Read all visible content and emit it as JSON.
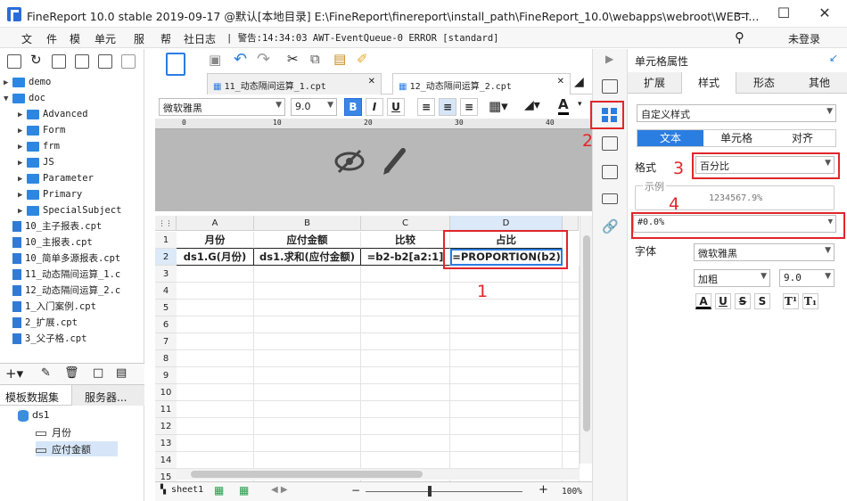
{
  "titlebar": {
    "title": "FineReport 10.0 stable 2019-09-17 @默认[本地目录]    E:\\FineReport\\finereport\\install_path\\FineReport_10.0\\webapps\\webroot\\WEB-I...",
    "minimize": "—",
    "maximize": "☐",
    "close": "✕"
  },
  "menubar": {
    "items": [
      "文",
      "件",
      "模",
      "单元",
      "服",
      "帮",
      "社日志"
    ],
    "status": "| 警告:14:34:03 AWT-EventQueue-0 ERROR [standard]",
    "login": "未登录"
  },
  "tree": {
    "items": [
      {
        "label": "demo",
        "type": "folder",
        "indent": 0
      },
      {
        "label": "doc",
        "type": "folder",
        "indent": 0
      },
      {
        "label": "Advanced",
        "type": "folder",
        "indent": 1
      },
      {
        "label": "Form",
        "type": "folder",
        "indent": 1
      },
      {
        "label": "frm",
        "type": "folder",
        "indent": 1
      },
      {
        "label": "JS",
        "type": "folder",
        "indent": 1
      },
      {
        "label": "Parameter",
        "type": "folder",
        "indent": 1
      },
      {
        "label": "Primary",
        "type": "folder",
        "indent": 1
      },
      {
        "label": "SpecialSubject",
        "type": "folder",
        "indent": 1
      },
      {
        "label": "10_主子报表.cpt",
        "type": "file",
        "indent": 0
      },
      {
        "label": "10_主报表.cpt",
        "type": "file",
        "indent": 0
      },
      {
        "label": "10_简单多源报表.cpt",
        "type": "file",
        "indent": 0
      },
      {
        "label": "11_动态隔间运算_1.c",
        "type": "file",
        "indent": 0
      },
      {
        "label": "12_动态隔间运算_2.c",
        "type": "file",
        "indent": 0
      },
      {
        "label": "1_入门案例.cpt",
        "type": "file",
        "indent": 0
      },
      {
        "label": "2_扩展.cpt",
        "type": "file",
        "indent": 0
      },
      {
        "label": "3_父子格.cpt",
        "type": "file",
        "indent": 0
      }
    ]
  },
  "dataset_panel": {
    "tabs": [
      "模板数据集",
      "服务器..."
    ],
    "dataset": "ds1",
    "fields": [
      "月份",
      "应付金额"
    ]
  },
  "tabs": [
    "11_动态隔间运算_1.cpt",
    "12_动态隔间运算_2.cpt"
  ],
  "fontbar": {
    "font": "微软雅黑",
    "size": "9.0",
    "bold": "B",
    "italic": "I",
    "underline": "U"
  },
  "grid": {
    "columns": [
      "A",
      "B",
      "C",
      "D"
    ],
    "rows": [
      "1",
      "2",
      "3",
      "4",
      "5",
      "6",
      "7",
      "8",
      "9",
      "10",
      "11",
      "12",
      "13",
      "14",
      "15"
    ],
    "row1": [
      "月份",
      "应付金额",
      "比较",
      "占比"
    ],
    "row2": [
      "ds1.G(月份)",
      "ds1.求和(应付金额)",
      "=b2-b2[a2:1]",
      "=PROPORTION(b2)"
    ]
  },
  "status": {
    "sheet": "sheet1",
    "zoom": "100%"
  },
  "rightpanel": {
    "header": "单元格属性",
    "tabs": [
      "扩展",
      "样式",
      "形态",
      "其他"
    ],
    "style_mode": "自定义样式",
    "subtabs": [
      "文本",
      "单元格",
      "对齐"
    ],
    "format_label": "格式",
    "format_value": "百分比",
    "example_label": "示例",
    "example_value": "1234567.9%",
    "pattern": "#0.0%",
    "font_label": "字体",
    "font_value": "微软雅黑",
    "weight": "加粗",
    "size": "9.0"
  },
  "annotations": [
    "1",
    "2",
    "3",
    "4"
  ],
  "colors": {
    "accent": "#2a7de1",
    "highlight": "#e0262a"
  }
}
